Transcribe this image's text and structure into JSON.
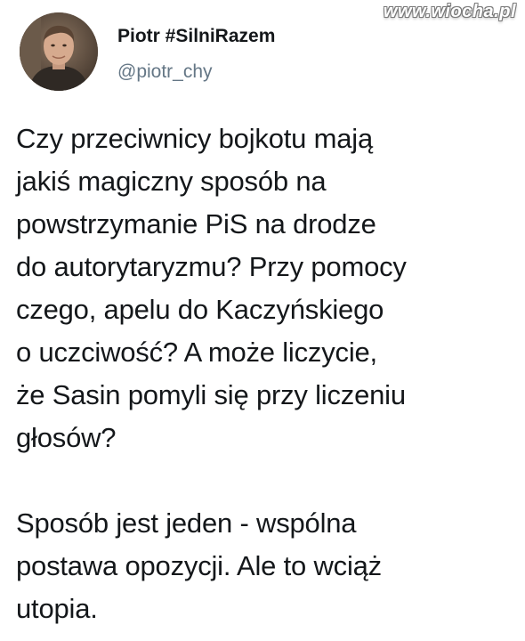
{
  "watermark": "www.wiocha.pl",
  "author": {
    "display_name": "Piotr #SilniRazem",
    "handle": "@piotr_chy",
    "avatar_icon": "user-avatar-photo"
  },
  "tweet": {
    "paragraphs": [
      {
        "lines": [
          "Czy przeciwnicy bojkotu mają",
          "jakiś magiczny sposób na",
          "powstrzymanie PiS na drodze",
          "do autorytaryzmu? Przy pomocy",
          "czego, apelu do Kaczyńskiego",
          "o uczciwość? A może liczycie,",
          "że Sasin pomyli się przy liczeniu",
          "głosów?"
        ]
      },
      {
        "lines": [
          "Sposób jest jeden - wspólna",
          "postawa opozycji. Ale to wciąż",
          "utopia."
        ]
      }
    ]
  },
  "colors": {
    "text": "#14171a",
    "secondary_text": "#657786",
    "background": "#ffffff"
  }
}
